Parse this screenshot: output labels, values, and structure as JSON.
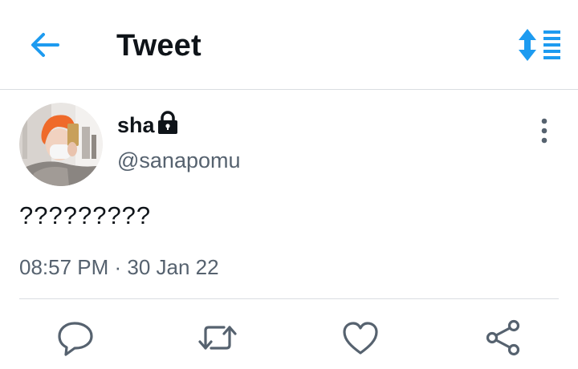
{
  "header": {
    "title": "Tweet",
    "back_icon": "arrow-left-icon",
    "sort_icon": "sort-icon",
    "accent_color": "#1d9bf0"
  },
  "tweet": {
    "user": {
      "name": "sha",
      "handle": "@sanapomu",
      "protected": true,
      "lock_icon": "lock-icon"
    },
    "text": "?????????",
    "timestamp": "08:57 PM · 30 Jan 22",
    "more_icon": "more-vertical-icon",
    "actions": [
      {
        "name": "reply",
        "icon": "comment-icon"
      },
      {
        "name": "retweet",
        "icon": "retweet-icon"
      },
      {
        "name": "like",
        "icon": "heart-icon"
      },
      {
        "name": "share",
        "icon": "share-icon"
      }
    ]
  },
  "colors": {
    "text_primary": "#0f1419",
    "text_secondary": "#56626f",
    "divider": "#d9dde1",
    "icon_gray": "#56626f"
  }
}
